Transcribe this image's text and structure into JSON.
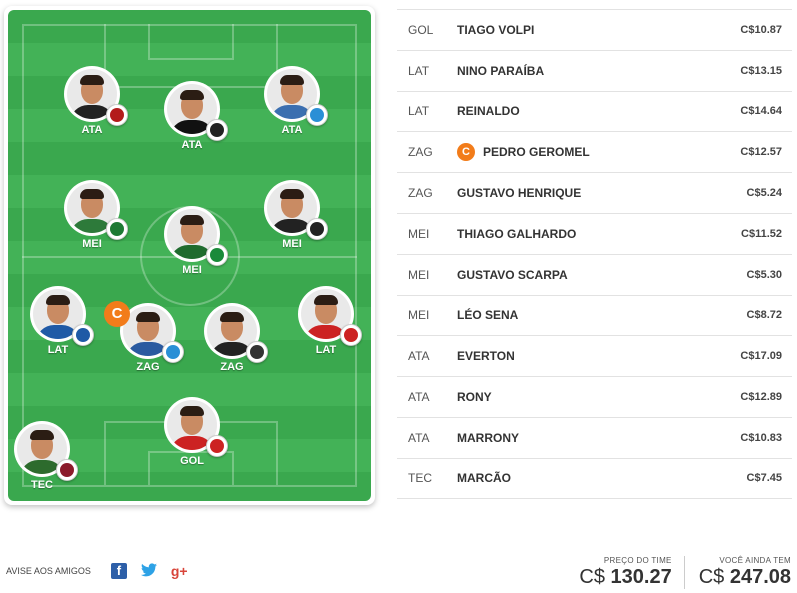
{
  "field": {
    "players": [
      {
        "pos": "ATA",
        "body": "#222",
        "badge": "#b31b1b"
      },
      {
        "pos": "ATA",
        "body": "#111",
        "badge": "#222"
      },
      {
        "pos": "ATA",
        "body": "#3b6fb0",
        "badge": "#2a8fd6"
      },
      {
        "pos": "MEI",
        "body": "#2d7a3a",
        "badge": "#1e7a34"
      },
      {
        "pos": "MEI",
        "body": "#1f6b2e",
        "badge": "#1a8a3a"
      },
      {
        "pos": "MEI",
        "body": "#222",
        "badge": "#222"
      },
      {
        "pos": "LAT",
        "body": "#1f5aa6",
        "badge": "#1f5aa6"
      },
      {
        "pos": "ZAG",
        "body": "#2a5aa0",
        "badge": "#2a8fd6"
      },
      {
        "pos": "ZAG",
        "body": "#222",
        "badge": "#333"
      },
      {
        "pos": "LAT",
        "body": "#c22",
        "badge": "#c22"
      },
      {
        "pos": "GOL",
        "body": "#c22",
        "badge": "#c22"
      },
      {
        "pos": "TEC",
        "body": "#2d6b2d",
        "badge": "#8b1a2b"
      }
    ],
    "captain_letter": "C"
  },
  "lineup": [
    {
      "pos": "GOL",
      "name": "TIAGO VOLPI",
      "price": "C$10.87",
      "captain": false
    },
    {
      "pos": "LAT",
      "name": "NINO PARAÍBA",
      "price": "C$13.15",
      "captain": false
    },
    {
      "pos": "LAT",
      "name": "REINALDO",
      "price": "C$14.64",
      "captain": false
    },
    {
      "pos": "ZAG",
      "name": "PEDRO GEROMEL",
      "price": "C$12.57",
      "captain": true
    },
    {
      "pos": "ZAG",
      "name": "GUSTAVO HENRIQUE",
      "price": "C$5.24",
      "captain": false
    },
    {
      "pos": "MEI",
      "name": "THIAGO GALHARDO",
      "price": "C$11.52",
      "captain": false
    },
    {
      "pos": "MEI",
      "name": "GUSTAVO SCARPA",
      "price": "C$5.30",
      "captain": false
    },
    {
      "pos": "MEI",
      "name": "LÉO SENA",
      "price": "C$8.72",
      "captain": false
    },
    {
      "pos": "ATA",
      "name": "EVERTON",
      "price": "C$17.09",
      "captain": false
    },
    {
      "pos": "ATA",
      "name": "RONY",
      "price": "C$12.89",
      "captain": false
    },
    {
      "pos": "ATA",
      "name": "MARRONY",
      "price": "C$10.83",
      "captain": false
    },
    {
      "pos": "TEC",
      "name": "MARCÃO",
      "price": "C$7.45",
      "captain": false
    }
  ],
  "share": {
    "label": "AVISE AOS AMIGOS",
    "facebook": "f",
    "twitter": "t",
    "gplus": "g+"
  },
  "totals": {
    "team_price_label": "PREÇO DO TIME",
    "currency": "C$",
    "team_price": "130.27",
    "remaining_label": "VOCÊ AINDA TEM",
    "remaining": "247.08"
  }
}
